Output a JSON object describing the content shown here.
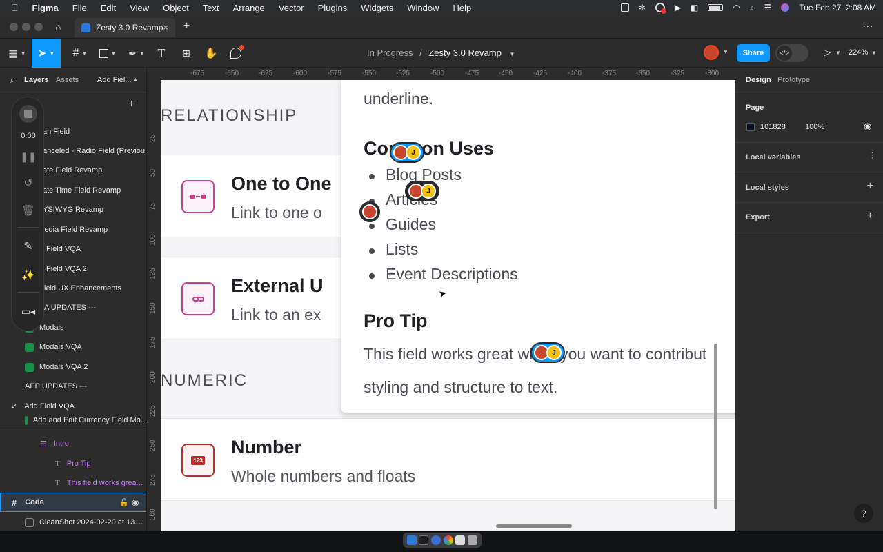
{
  "menubar": {
    "apple": "",
    "app": "Figma",
    "items": [
      "File",
      "Edit",
      "View",
      "Object",
      "Text",
      "Arrange",
      "Vector",
      "Plugins",
      "Widgets",
      "Window",
      "Help"
    ],
    "datetime": "Tue Feb 27  2:08 AM"
  },
  "tabbar": {
    "tab_title": "Zesty 3.0 Revamp",
    "close": "×",
    "new_tab": "+",
    "more": "⋯"
  },
  "toolbar": {
    "breadcrumb_parent": "In Progress",
    "breadcrumb_sep": "/",
    "breadcrumb_file": "Zesty 3.0 Revamp",
    "share_label": "Share",
    "dev_icon": "</>",
    "zoom": "224%"
  },
  "left_panel": {
    "tabs": {
      "layers": "Layers",
      "assets": "Assets",
      "page": "Add Fiel..."
    },
    "recorder_time": "0:00",
    "layers": [
      "an Field",
      "anceled - Radio Field (Previou...",
      "ate Field Revamp",
      "ate Time Field Revamp",
      "YSIWYG Revamp",
      "ledia Field Revamp",
      "Field VQA",
      "Field VQA 2",
      "ield UX Enhancements",
      "A UPDATES ---",
      "Modals",
      "Modals VQA",
      "Modals VQA 2",
      "APP UPDATES ---",
      "Add Field VQA",
      "Add and Edit Currency Field Mo..."
    ],
    "sublayers": [
      "Intro",
      "Pro Tip",
      "This field works grea..."
    ],
    "frame_code": "Code",
    "frame_screenshot": "CleanShot 2024-02-20 at 13...."
  },
  "rulers": {
    "top": [
      "-675",
      "-650",
      "-625",
      "-600",
      "-575",
      "-550",
      "-525",
      "-500",
      "-475",
      "-450",
      "-425",
      "-400",
      "-375",
      "-350",
      "-325",
      "-300"
    ],
    "left": [
      "25",
      "50",
      "75",
      "100",
      "125",
      "150",
      "175",
      "200",
      "225",
      "250",
      "275",
      "300"
    ]
  },
  "canvas": {
    "section_relationship": "RELATIONSHIP",
    "section_numeric": "NUMERIC",
    "cards": [
      {
        "title": "One to One",
        "desc": "Link to one o"
      },
      {
        "title": "External U",
        "desc": "Link to an ex"
      },
      {
        "title": "Number",
        "desc": "Whole numbers and floats",
        "badge": "123"
      }
    ],
    "popup": {
      "top_text": "underline.",
      "common_heading": "Common Uses",
      "uses": [
        "Blog Posts",
        "Articles",
        "Guides",
        "Lists",
        "Event Descriptions"
      ],
      "protip_heading": "Pro Tip",
      "protip_line1": "This field works great when you want to contribut",
      "protip_line2": "styling and structure to text."
    },
    "avatar_initial": "J"
  },
  "right_panel": {
    "tabs": {
      "design": "Design",
      "prototype": "Prototype"
    },
    "page_label": "Page",
    "page_color": "101828",
    "page_opacity": "100%",
    "local_variables": "Local variables",
    "local_styles": "Local styles",
    "export": "Export",
    "help": "?"
  },
  "colors": {
    "accent": "#0d99ff",
    "pink": "#d33b8f",
    "red_badge": "#c62828"
  }
}
